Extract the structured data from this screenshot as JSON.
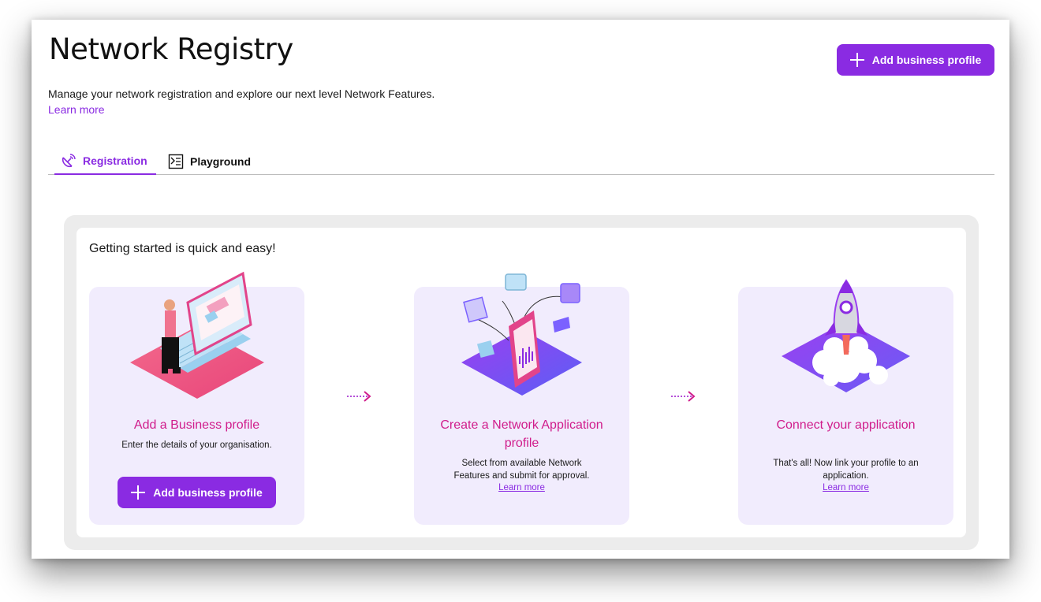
{
  "header": {
    "title": "Network Registry",
    "add_button_label": "Add business profile",
    "subtitle": "Manage your network registration and explore our next level Network Features.",
    "learn_more": "Learn more"
  },
  "tabs": [
    {
      "label": "Registration",
      "icon": "satellite-dish-icon",
      "active": true
    },
    {
      "label": "Playground",
      "icon": "terminal-icon",
      "active": false
    }
  ],
  "getting_started": {
    "intro": "Getting started is quick and easy!",
    "steps": [
      {
        "title": "Add a Business profile",
        "description": "Enter the details of your organisation.",
        "button_label": "Add business profile"
      },
      {
        "title": "Create a Network Application profile",
        "description": "Select from available Network Features and submit for approval.",
        "link": "Learn more"
      },
      {
        "title": "Connect your application",
        "description": "That's all! Now link your profile to an application.",
        "link": "Learn more"
      }
    ]
  },
  "colors": {
    "accent": "#8a2be2",
    "step_title": "#d01c8b",
    "card_bg": "#f1ecfd",
    "panel_bg": "#ececec"
  }
}
